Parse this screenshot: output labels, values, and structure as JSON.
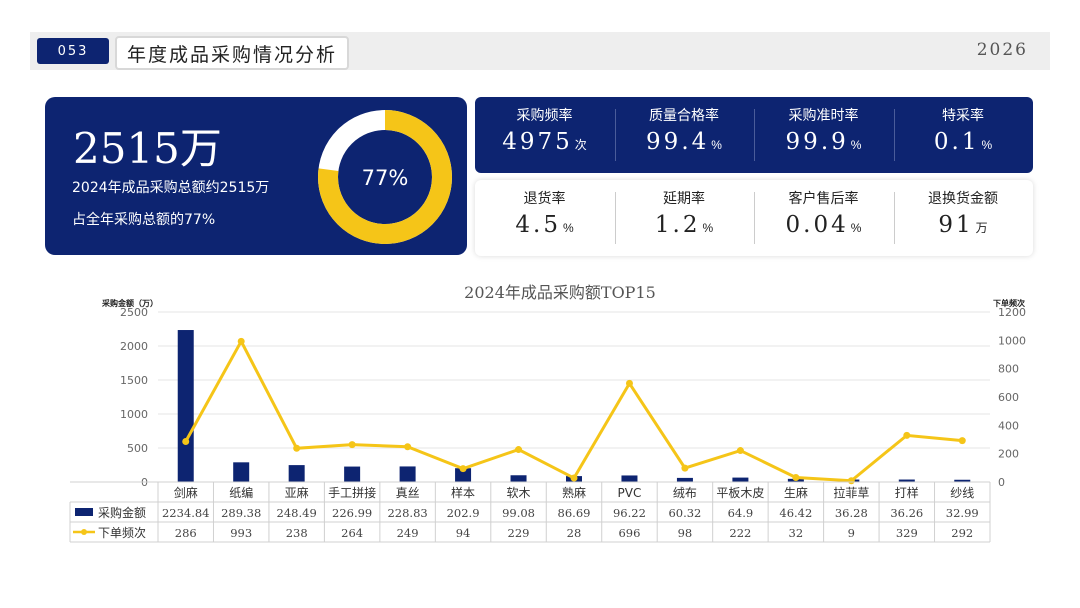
{
  "header": {
    "page_number": "053",
    "title": "年度成品采购情况分析",
    "year": "2026"
  },
  "summary": {
    "big_value": "2515万",
    "line1": "2024年成品采购总额约2515万",
    "line2": "占全年采购总额的77%",
    "donut_label": "77%",
    "donut_fraction": 0.77,
    "colors": {
      "panel": "#0d2471",
      "ring_fill": "#f5c518",
      "ring_track": "#ffffff"
    }
  },
  "kpis_top": [
    {
      "label": "采购频率",
      "value": "4975",
      "unit": "次"
    },
    {
      "label": "质量合格率",
      "value": "99.4",
      "unit": "%"
    },
    {
      "label": "采购准时率",
      "value": "99.9",
      "unit": "%"
    },
    {
      "label": "特采率",
      "value": "0.1",
      "unit": "%"
    }
  ],
  "kpis_bottom": [
    {
      "label": "退货率",
      "value": "4.5",
      "unit": "%"
    },
    {
      "label": "延期率",
      "value": "1.2",
      "unit": "%"
    },
    {
      "label": "客户售后率",
      "value": "0.04",
      "unit": "%"
    },
    {
      "label": "退换货金额",
      "value": "91",
      "unit": "万"
    }
  ],
  "chart_data": {
    "type": "bar",
    "title": "2024年成品采购额TOP15",
    "ylabel_left": "采购金额（万）",
    "ylabel_right": "下单频次",
    "ylim_left": [
      0,
      2500
    ],
    "ylim_right": [
      0,
      1200
    ],
    "yticks_left": [
      "0",
      "500",
      "1000",
      "1500",
      "2000",
      "2500"
    ],
    "yticks_right": [
      "0",
      "200",
      "400",
      "600",
      "800",
      "1000",
      "1200"
    ],
    "grid": true,
    "categories": [
      "剑麻",
      "纸编",
      "亚麻",
      "手工拼接",
      "真丝",
      "样本",
      "软木",
      "熟麻",
      "PVC",
      "绒布",
      "平板木皮",
      "生麻",
      "拉菲草",
      "打样",
      "纱线"
    ],
    "series": [
      {
        "name": "采购金额",
        "kind": "bar",
        "axis": "left",
        "color": "#0d2471",
        "values": [
          2234.84,
          289.38,
          248.49,
          226.99,
          228.83,
          202.9,
          99.08,
          86.69,
          96.22,
          60.32,
          64.9,
          46.42,
          36.28,
          36.26,
          32.99
        ],
        "labels": [
          "2234.84",
          "289.38",
          "248.49",
          "226.99",
          "228.83",
          "202.9",
          "99.08",
          "86.69",
          "96.22",
          "60.32",
          "64.9",
          "46.42",
          "36.28",
          "36.26",
          "32.99"
        ]
      },
      {
        "name": "下单频次",
        "kind": "line",
        "axis": "right",
        "color": "#f5c518",
        "values": [
          286,
          993,
          238,
          264,
          249,
          94,
          229,
          28,
          696,
          98,
          222,
          32,
          9,
          329,
          292
        ],
        "labels": [
          "286",
          "993",
          "238",
          "264",
          "249",
          "94",
          "229",
          "28",
          "696",
          "98",
          "222",
          "32",
          "9",
          "329",
          "292"
        ]
      }
    ]
  }
}
